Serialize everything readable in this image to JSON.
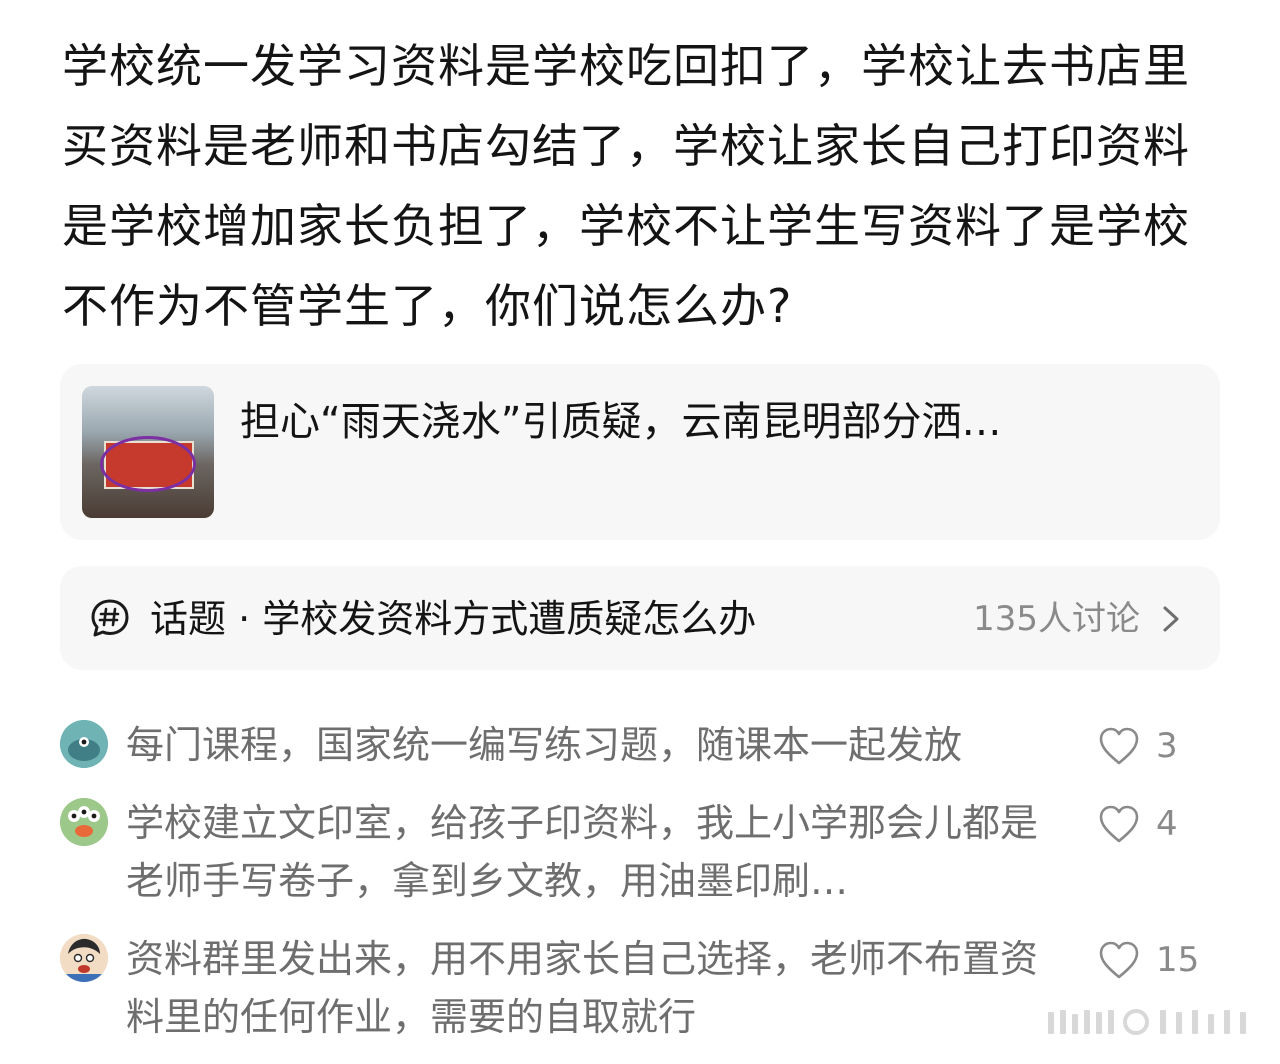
{
  "post": {
    "text": "学校统一发学习资料是学校吃回扣了，学校让去书店里买资料是老师和书店勾结了，学校让家长自己打印资料是学校增加家长负担了，学校不让学生写资料了是学校不作为不管学生了，你们说怎么办?"
  },
  "link_card": {
    "title": "担心“雨天浇水”引质疑，云南昆明部分洒…"
  },
  "topic": {
    "icon": "hashtag-bubble-icon",
    "label": "话题 · 学校发资料方式遭质疑怎么办",
    "count": "135人讨论",
    "chevron_icon": "chevron-right-icon"
  },
  "comments": [
    {
      "text": "每门课程，国家统一编写练习题，随课本一起发放",
      "likes": "3",
      "avatar_color": "#5aa8a6"
    },
    {
      "text": "学校建立文印室，给孩子印资料，我上小学那会儿都是老师手写卷子，拿到乡文教，用油墨印刷…",
      "likes": "4",
      "avatar_color": "#8cbf7a"
    },
    {
      "text": "资料群里发出来，用不用家长自己选择，老师不布置资料里的任何作业，需要的自取就行",
      "likes": "15",
      "avatar_color": "#e8c9a8"
    }
  ],
  "colors": {
    "text_primary": "#141414",
    "text_secondary": "#6e6e6e",
    "muted": "#8a8a8a",
    "card_bg": "#f7f7f7"
  }
}
